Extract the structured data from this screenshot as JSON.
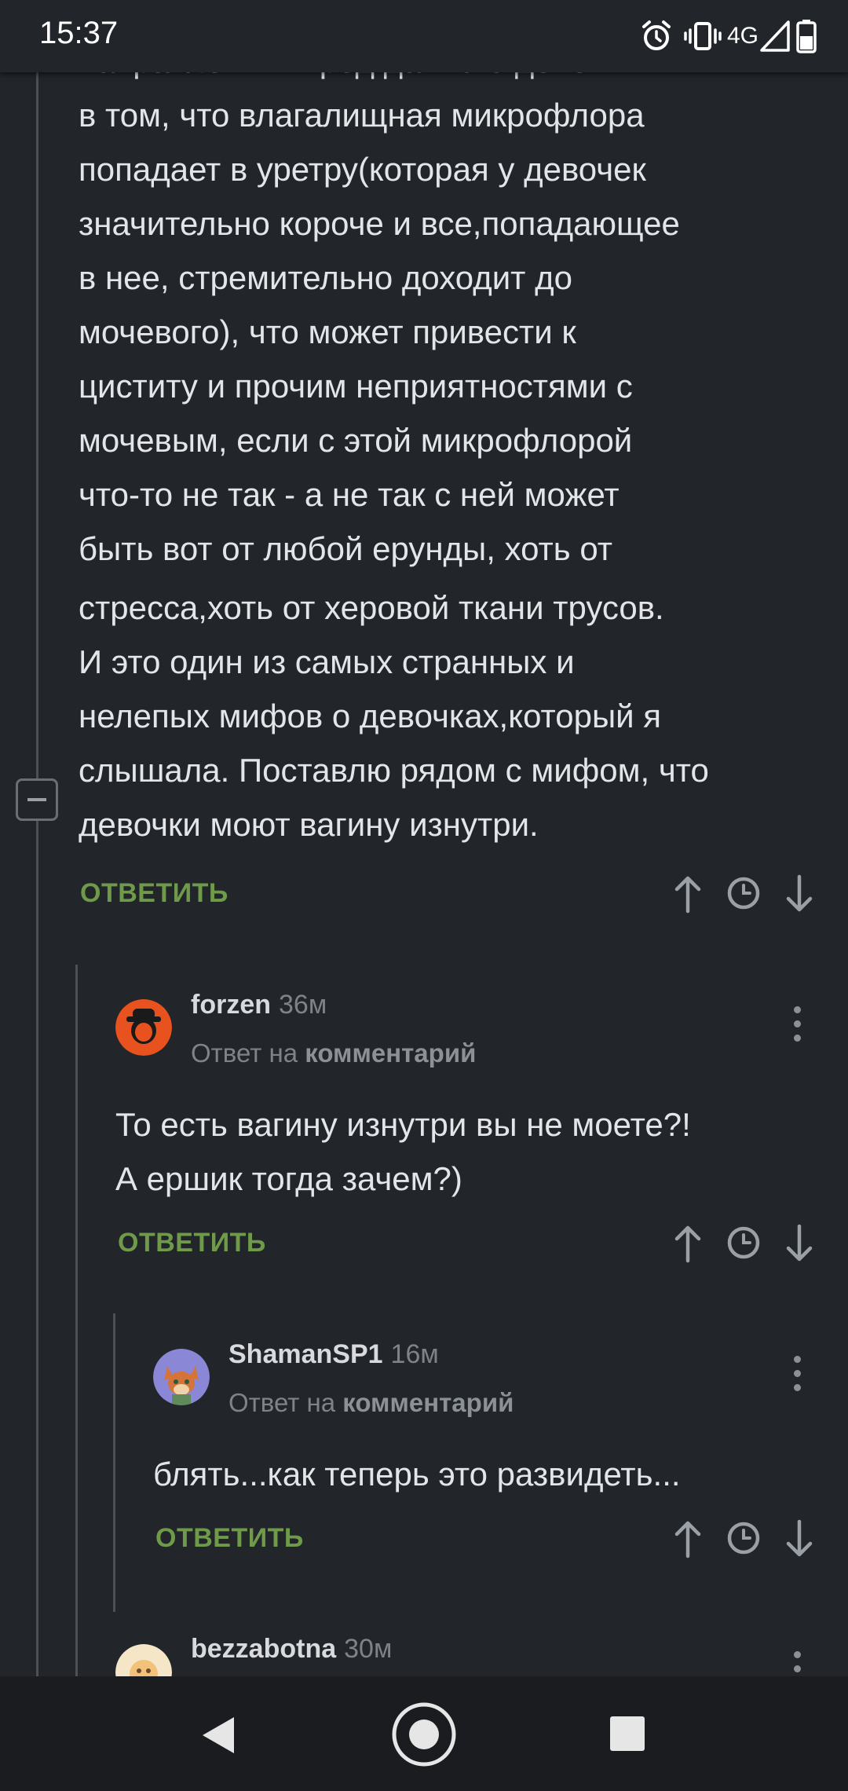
{
  "status_bar": {
    "time": "15:37",
    "network": "4G"
  },
  "main_comment": {
    "lines": [
      "направлении. Вред данного действия",
      "в том, что влагалищная микрофлора",
      "попадает в уретру(которая у девочек",
      "значительно короче и все,попадающее",
      "в нее, стремительно доходит до",
      "мочевого), что может привести к",
      "циститу и прочим неприятностями с",
      "мочевым, если с этой микрофлорой",
      "что-то не так - а не так с ней может",
      "быть вот от любой ерунды, хоть от",
      "стресса,хоть от херовой ткани трусов.",
      "И это один из самых странных и",
      "нелепых мифов о девочках,который я",
      "слышала. Поставлю рядом с мифом, что",
      "девочки моют вагину изнутри."
    ],
    "reply_label": "ОТВЕТИТЬ"
  },
  "comments": [
    {
      "author": "forzen",
      "time": "36м",
      "reply_prefix": "Ответ на",
      "reply_target": "комментарий",
      "text_lines": [
        "То есть вагину изнутри вы не моете?!",
        "А ершик тогда зачем?)"
      ],
      "reply_label": "ОТВЕТИТЬ"
    },
    {
      "author": "ShamanSP1",
      "time": "16м",
      "reply_prefix": "Ответ на",
      "reply_target": "комментарий",
      "text_lines": [
        "блять...как теперь это развидеть..."
      ],
      "reply_label": "ОТВЕТИТЬ"
    },
    {
      "author": "bezzabotna",
      "time": "30м"
    }
  ],
  "colors": {
    "background": "#22262a",
    "accent_reply": "#6e9a49",
    "text": "#e3e5e8",
    "muted": "#7e8389"
  },
  "icons": {
    "status": [
      "alarm-icon",
      "vibrate-icon",
      "signal-icon",
      "battery-icon"
    ],
    "actions": [
      "arrow-up-icon",
      "clock-icon",
      "arrow-down-icon"
    ],
    "nav": [
      "back-icon",
      "home-icon",
      "recents-icon"
    ]
  }
}
